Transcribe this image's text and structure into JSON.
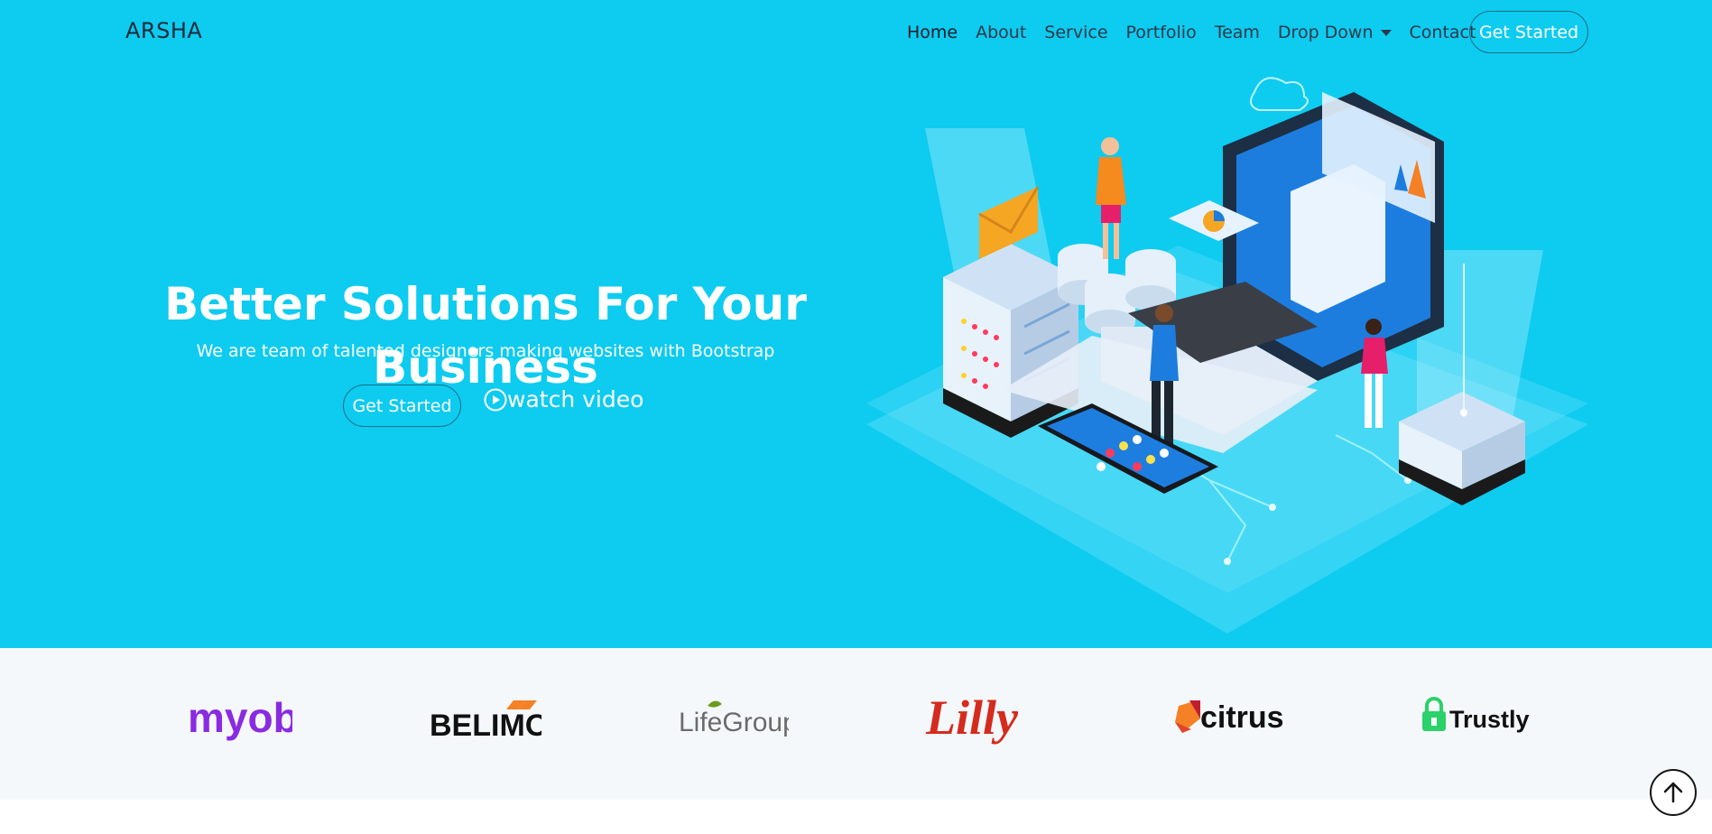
{
  "header": {
    "brand": "ARSHA",
    "nav": [
      "Home",
      "About",
      "Service",
      "Portfolio",
      "Team",
      "Drop Down",
      "Contact"
    ],
    "cta": "Get Started"
  },
  "hero": {
    "title": "Better Solutions For Your Business",
    "subtitle": "We are team of talented designers making websites with Bootstrap",
    "cta": "Get Started",
    "watch": "watch video"
  },
  "clients": {
    "logos": [
      "myob",
      "BELIMO",
      "LifeGroups",
      "Lilly",
      "citrus",
      "Trustly"
    ]
  },
  "colors": {
    "hero_bg": "#0ecbf0",
    "clients_bg": "#f5f8fa",
    "myob": "#8a2be2",
    "lilly": "#d52b1e",
    "citrus_orange": "#f58025",
    "trustly_green": "#0ee06e"
  },
  "icons": [
    "play-circle-icon",
    "caret-down-icon",
    "arrow-up-icon"
  ]
}
